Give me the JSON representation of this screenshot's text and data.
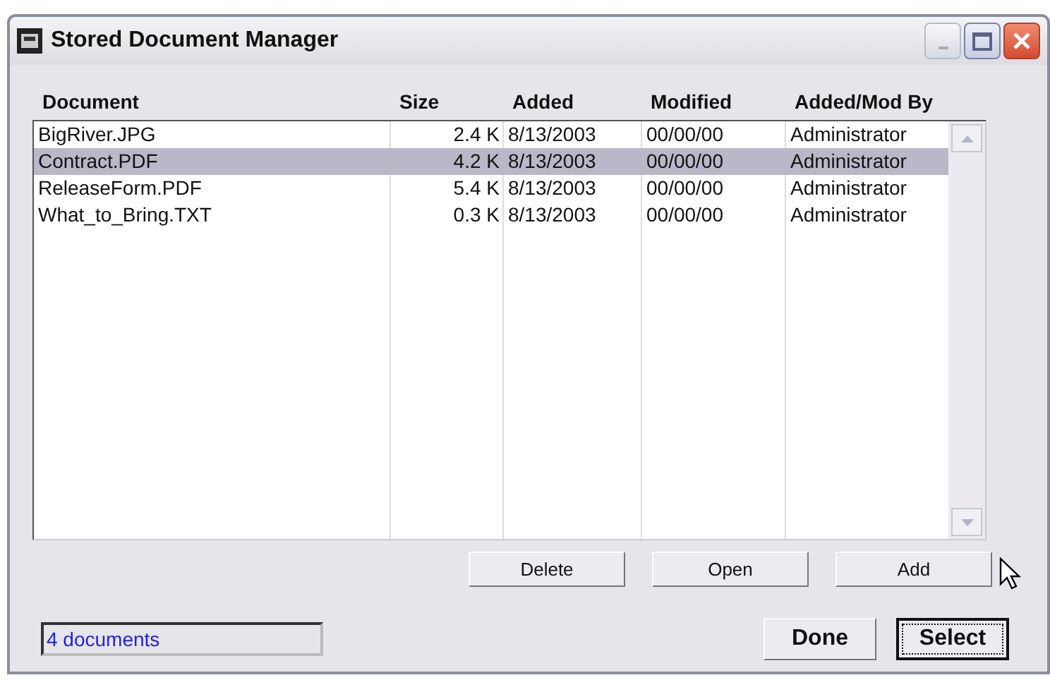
{
  "window": {
    "title": "Stored Document Manager"
  },
  "table": {
    "columns": [
      "Document",
      "Size",
      "Added",
      "Modified",
      "Added/Mod By"
    ],
    "rows": [
      {
        "cells": [
          "BigRiver.JPG",
          "2.4 K",
          "8/13/2003",
          "00/00/00",
          "Administrator"
        ],
        "selected": false
      },
      {
        "cells": [
          "Contract.PDF",
          "4.2 K",
          "8/13/2003",
          "00/00/00",
          "Administrator"
        ],
        "selected": true
      },
      {
        "cells": [
          "ReleaseForm.PDF",
          "5.4 K",
          "8/13/2003",
          "00/00/00",
          "Administrator"
        ],
        "selected": false
      },
      {
        "cells": [
          "What_to_Bring.TXT",
          "0.3 K",
          "8/13/2003",
          "00/00/00",
          "Administrator"
        ],
        "selected": false
      }
    ]
  },
  "actions": [
    "Delete",
    "Open",
    "Add"
  ],
  "status": "4 documents",
  "dialog_buttons": [
    {
      "label": "Done",
      "default": false
    },
    {
      "label": "Select",
      "default": true
    }
  ]
}
